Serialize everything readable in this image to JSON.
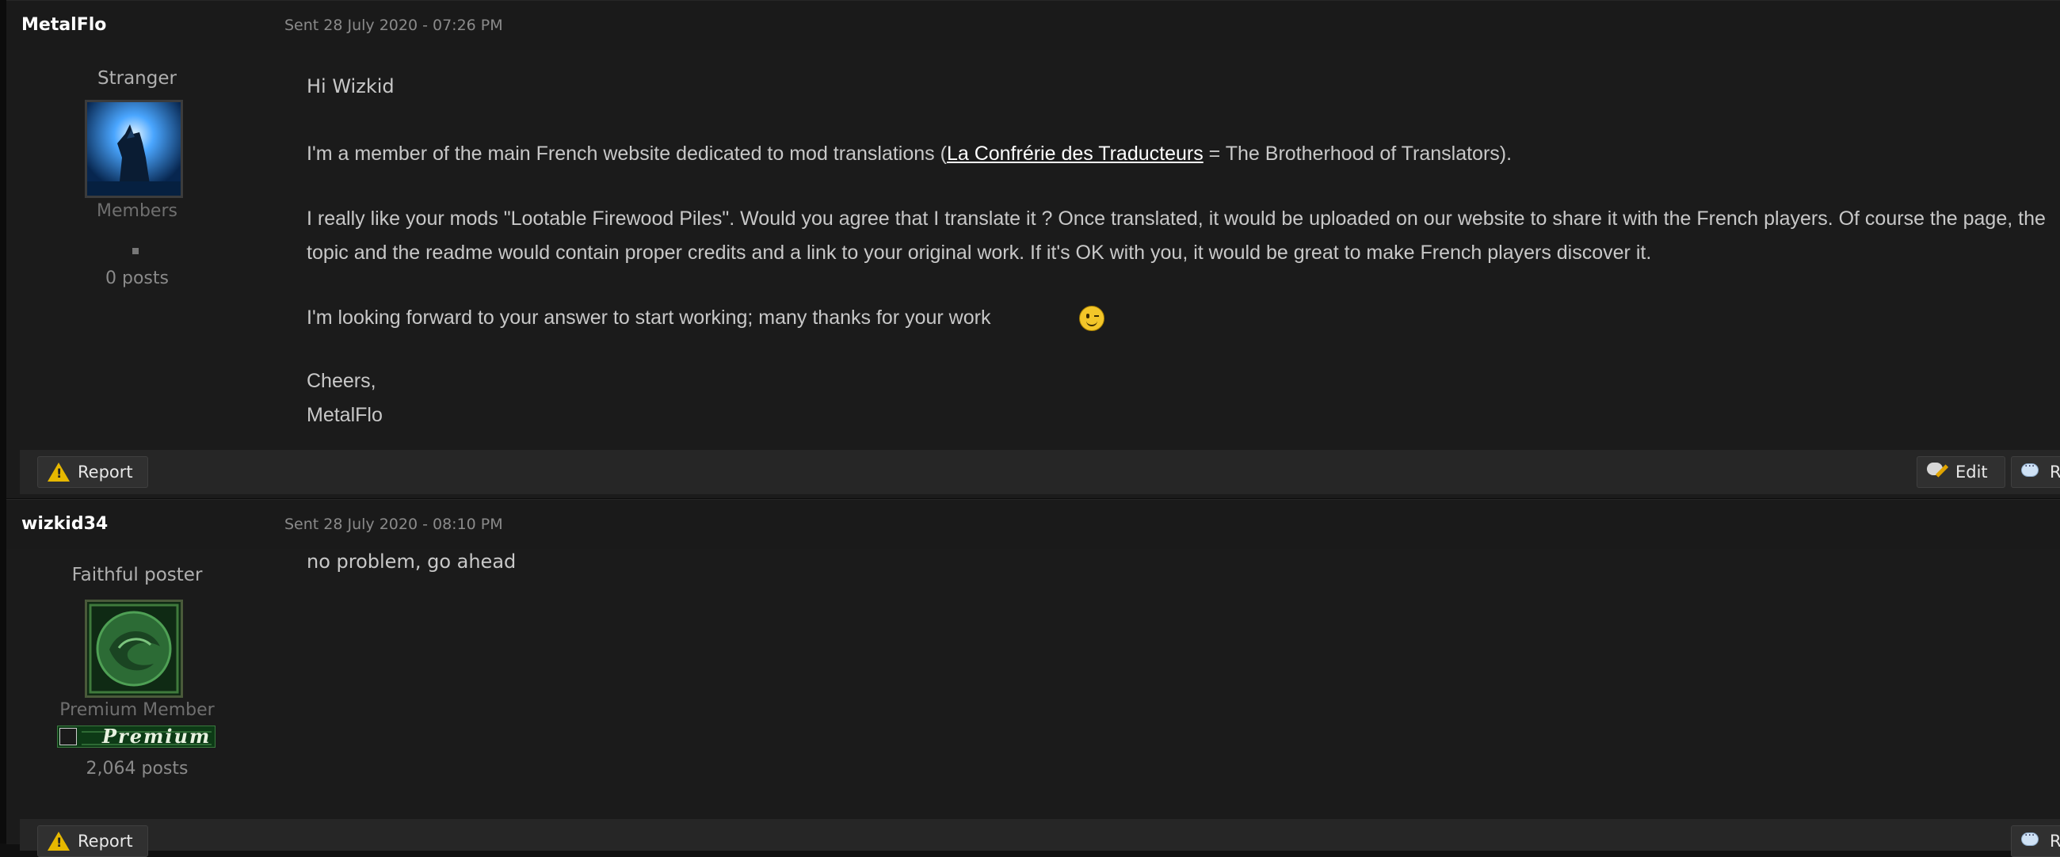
{
  "posts": [
    {
      "author": "MetalFlo",
      "date": "Sent 28 July 2020 - 07:26 PM",
      "rank": "Stranger",
      "avatar_icon": "wolf-avatar-icon",
      "group": "Members",
      "posts_count": "0 posts",
      "message": {
        "greeting": "Hi Wizkid",
        "p1_before": "I'm a member of the main French website dedicated to mod translations (",
        "p1_link": "La Confrérie des Traducteurs",
        "p1_after": " = The Brotherhood of Translators).",
        "p2": "I really like your mods \"Lootable Firewood Piles\". Would you agree that I translate it ? Once translated, it would be uploaded on our website to share it with the French players. Of course the page, the topic and the readme would contain proper credits and a link to your original work. If it's OK with you, it would be great to make French players discover it.",
        "p3": "I'm looking forward to your answer to start working; many thanks for your work",
        "signoff_1": "Cheers,",
        "signoff_2": "MetalFlo"
      },
      "actions": {
        "report": "Report",
        "edit": "Edit",
        "reply": "Re"
      }
    },
    {
      "author": "wizkid34",
      "date": "Sent 28 July 2020 - 08:10 PM",
      "rank": "Faithful poster",
      "avatar_icon": "green-dragon-medallion-icon",
      "group": "Premium Member",
      "badge": "Premium",
      "posts_count": "2,064 posts",
      "message": {
        "text": "no problem, go ahead"
      },
      "actions": {
        "report": "Report",
        "reply": "Re"
      }
    }
  ],
  "colors": {
    "background": "#0c0c0c",
    "post_bg": "#1b1b1b",
    "action_bar": "#262626",
    "link": "#ffffff",
    "premium_green": "#0d3a16"
  }
}
